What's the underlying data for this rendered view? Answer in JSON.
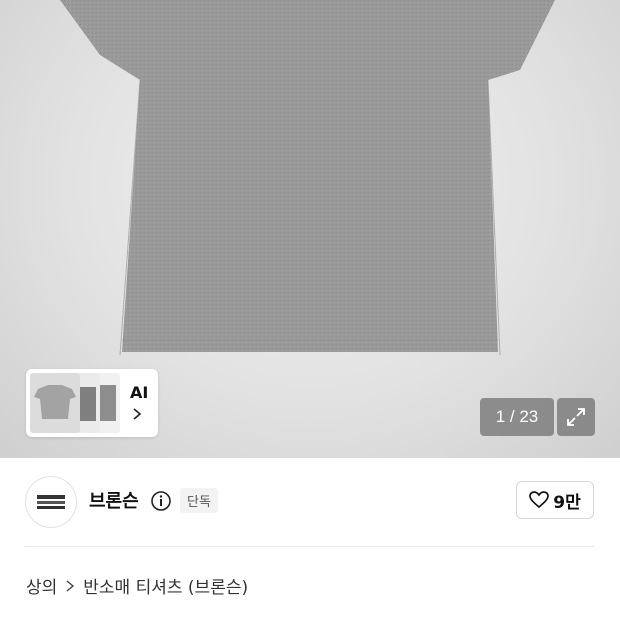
{
  "gallery": {
    "counter": "1 / 23",
    "ai_label": "AI"
  },
  "brand": {
    "name": "브론슨",
    "exclusive_badge": "단독",
    "likes": "9만"
  },
  "breadcrumb": {
    "category": "상의",
    "subcategory": "반소매 티셔츠 (브론슨)"
  },
  "colors": {
    "shirt": "#9a9a9a",
    "overlay": "#6e6e6e"
  }
}
